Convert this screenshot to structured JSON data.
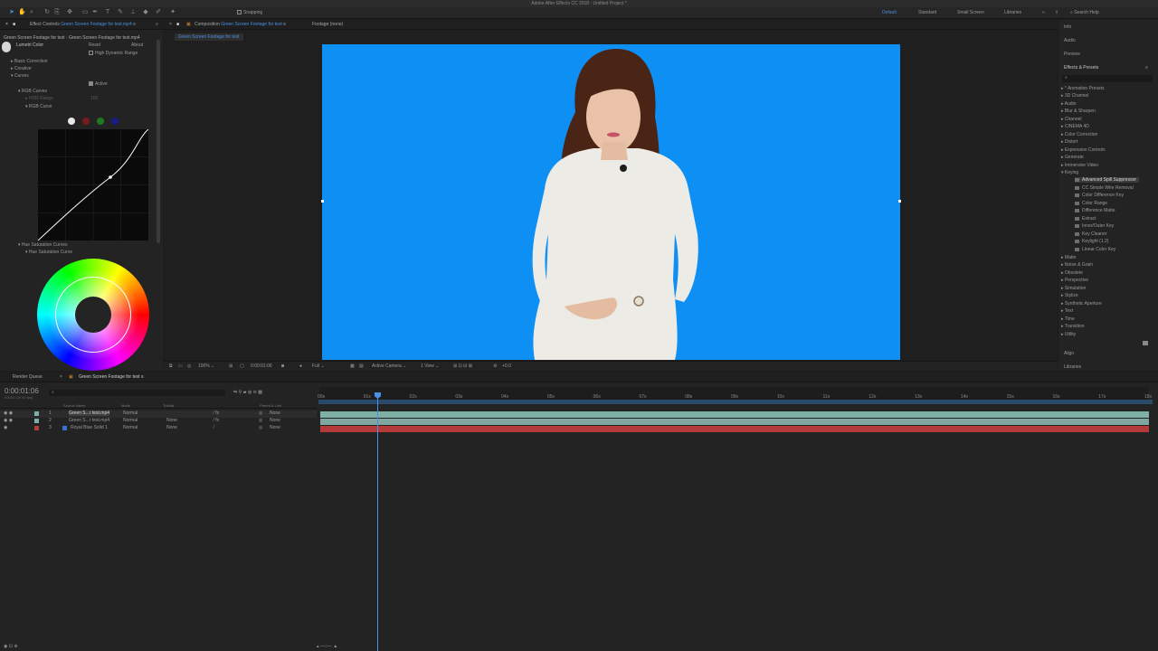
{
  "app": {
    "title": "Adobe After Effects CC 2018 - Untitled Project *"
  },
  "toolbar": {
    "snapping_label": "Snapping"
  },
  "workspaces": {
    "items": [
      "Default",
      "Standard",
      "Small Screen",
      "Libraries"
    ],
    "search_placeholder": "Search Help"
  },
  "effect_controls": {
    "tab": "Effect Controls",
    "tab_layer": "Green Screen Footage for test.mp4",
    "breadcrumb": "Green Screen Footage for test · Green Screen Footage for test.mp4",
    "effect_name": "Lumetri Color",
    "reset": "Reset",
    "about": "About",
    "hdr_label": "High Dynamic Range",
    "basic_correction": "Basic Correction",
    "creative": "Creative",
    "curves": "Curves",
    "active_label": "Active",
    "rgb_curves": "RGB Curves",
    "hdr_range": "HDR Range",
    "hdr_value": "100",
    "rgb_curve": "RGB Curve",
    "hue_sat_curves": "Hue Saturation Curves",
    "hue_sat_curve": "Hue Saturation Curve",
    "curve_dots": [
      "#e8e8e8",
      "#7a1a1a",
      "#1d7a1d",
      "#1a1a8a"
    ]
  },
  "composition": {
    "tab": "Composition",
    "tab_name": "Green Screen Footage for test",
    "footage_tab": "Footage (none)",
    "sub_tab": "Green Screen Footage for test",
    "screen_color": "#0e8ff4",
    "zoom": "100%",
    "timecode": "0:00:01:06",
    "resolution": "Full",
    "camera": "Active Camera",
    "view": "1 View",
    "exposure": "+0.0"
  },
  "right_panels": {
    "info": "Info",
    "audio": "Audio",
    "preview": "Preview",
    "effects_presets": "Effects & Presets",
    "search": "",
    "align": "Align",
    "libraries": "Libraries"
  },
  "effects_list": {
    "categories_a": [
      "* Animation Presets",
      "3D Channel",
      "Audio",
      "Blur & Sharpen",
      "Channel",
      "CINEMA 4D",
      "Color Correction",
      "Distort",
      "Expression Controls",
      "Generate",
      "Immersive Video",
      "Keying"
    ],
    "keying": [
      "Advanced Spill Suppressor",
      "CC Simple Wire Removal",
      "Color Difference Key",
      "Color Range",
      "Difference Matte",
      "Extract",
      "Inner/Outer Key",
      "Key Cleaner",
      "Keylight (1.2)",
      "Linear Color Key"
    ],
    "categories_b": [
      "Matte",
      "Noise & Grain",
      "Obsolete",
      "Perspective",
      "Simulation",
      "Stylize",
      "Synthetic Aperture",
      "Text",
      "Time",
      "Transition",
      "Utility"
    ]
  },
  "timeline": {
    "render_queue": "Render Queue",
    "comp_tab": "Green Screen Footage for test",
    "timecode": "0:00:01:06",
    "frame_info": "00031 (25.00 fps)",
    "headers": {
      "source": "Source Name",
      "mode": "Mode",
      "trkmat": "TrkMat",
      "parent": "Parent & Link"
    },
    "layers": [
      {
        "num": "1",
        "name": "Green S...r test.mp4",
        "mode": "Normal",
        "trkmat": "",
        "parent": "None",
        "color": "#7fb0a8"
      },
      {
        "num": "2",
        "name": "Green S...r test.mp4",
        "mode": "Normal",
        "trkmat": "None",
        "parent": "None",
        "color": "#7fb0a8"
      },
      {
        "num": "3",
        "name": "Royal Blue Solid 1",
        "mode": "Normal",
        "trkmat": "None",
        "parent": "None",
        "color": "#b53a3a"
      }
    ],
    "ticks": [
      "00s",
      "01s",
      "02s",
      "03s",
      "04s",
      "05s",
      "06s",
      "07s",
      "08s",
      "09s",
      "10s",
      "11s",
      "12s",
      "13s",
      "14s",
      "15s",
      "16s",
      "17s",
      "18s"
    ]
  }
}
